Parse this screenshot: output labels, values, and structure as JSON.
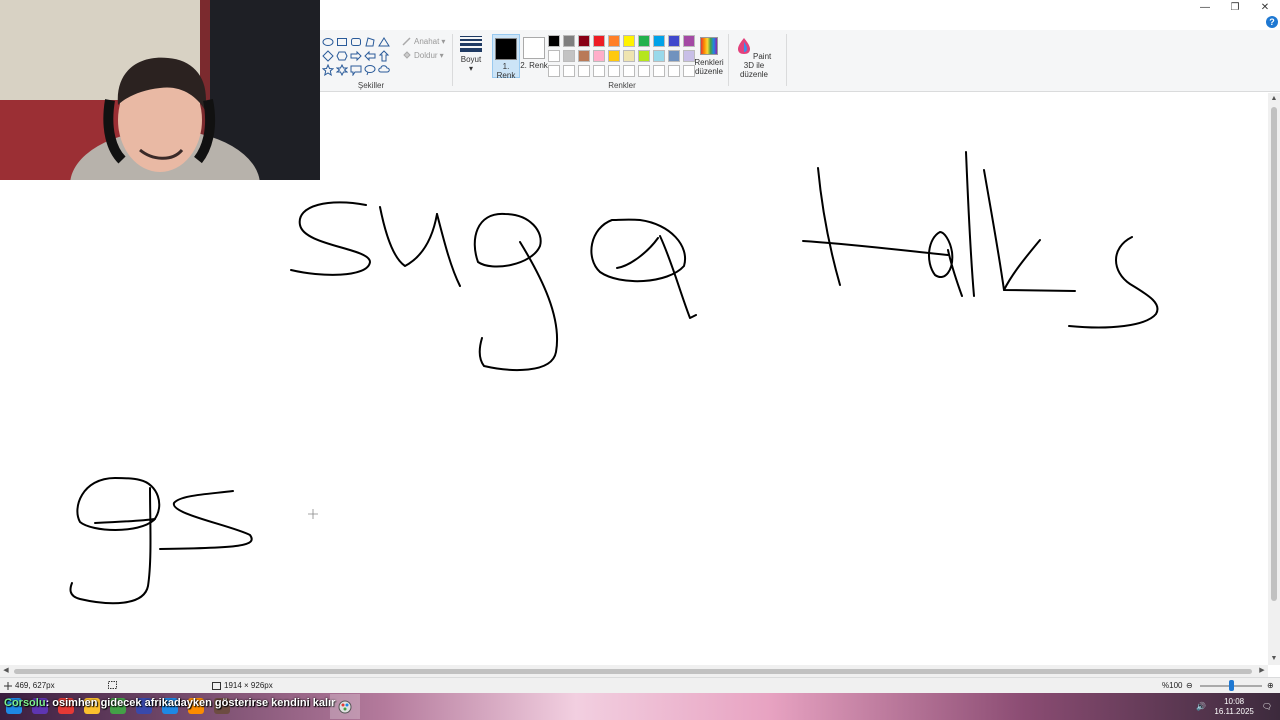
{
  "window": {
    "minimize_icon": "minimize-icon",
    "restore_icon": "restore-icon",
    "close_icon": "close-icon",
    "minimize_glyph": "—",
    "restore_glyph": "❐",
    "close_glyph": "✕"
  },
  "ribbon": {
    "shapes_group_label": "Şekiller",
    "outline_label": "Anahat",
    "fill_label": "Doldur",
    "size_label": "Boyut",
    "color1_label": "1. Renk",
    "color2_label": "2. Renk",
    "colors_group_label": "Renkler",
    "edit_colors_label": "Renkleri düzenle",
    "paint3d_label": "Paint 3D ile düzenle",
    "help_glyph": "?",
    "color1": "#000000",
    "color2": "#ffffff",
    "palette": [
      "#000000",
      "#7f7f7f",
      "#880015",
      "#ed1c24",
      "#ff7f27",
      "#fff200",
      "#22b14c",
      "#00a2e8",
      "#3f48cc",
      "#a349a4",
      "#ffffff",
      "#c3c3c3",
      "#b97a57",
      "#ffaec9",
      "#ffc90e",
      "#efe4b0",
      "#b5e61d",
      "#99d9ea",
      "#7092be",
      "#c8bfe7",
      "#ffffff",
      "#ffffff",
      "#ffffff",
      "#ffffff",
      "#ffffff",
      "#ffffff",
      "#ffffff",
      "#ffffff",
      "#ffffff",
      "#ffffff"
    ]
  },
  "status": {
    "cursor_pos": "469, 627px",
    "image_size": "1914 × 926px",
    "zoom": "%100"
  },
  "taskbar": {
    "chat_user": "Corsolu",
    "chat_message": ": osimhen gidecek afrikadayken gösterirse kendini kalır",
    "clock_time": "10:08",
    "clock_date": "16.11.2025"
  }
}
